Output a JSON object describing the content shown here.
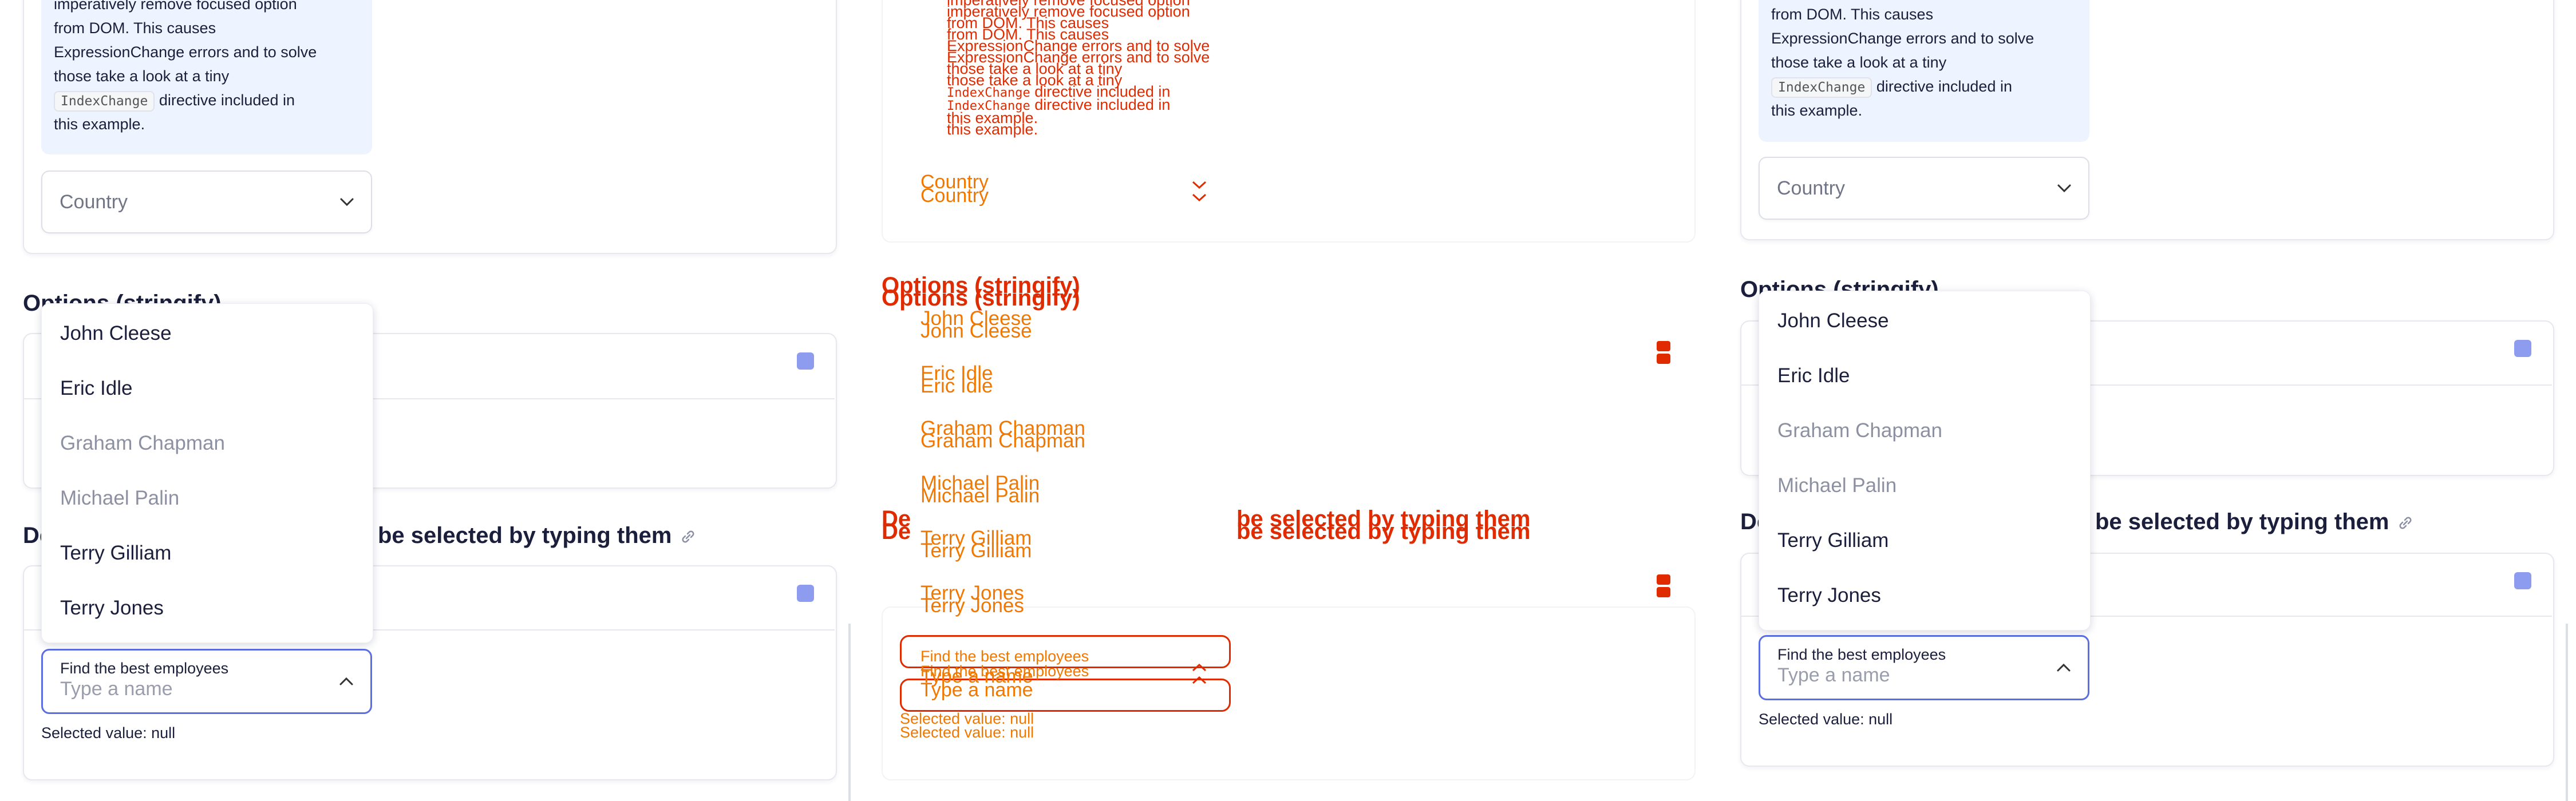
{
  "notice": {
    "line1": "imperatively remove focused option",
    "line2": "from DOM. This causes",
    "line3": "ExpressionChange errors and to solve",
    "line4": "those take a look at a tiny",
    "code": "IndexChange",
    "line5": "directive included in",
    "line6": "this example."
  },
  "country_select": {
    "placeholder": "Country"
  },
  "sections": {
    "options_stringify": "Options (stringify)",
    "typing_title_right": "be selected by typing them",
    "typing_title_left": "De"
  },
  "options": [
    "John Cleese",
    "Eric Idle",
    "Graham Chapman",
    "Michael Palin",
    "Terry Gilliam",
    "Terry Jones"
  ],
  "employee_field": {
    "label": "Find the best employees",
    "placeholder": "Type a name"
  },
  "selected_value": "Selected value: null",
  "colors": {
    "accent": "#5b6fe0",
    "debug_red": "#e02b00",
    "debug_orange": "#f07800",
    "notice_bg": "#edf4ff"
  },
  "icons": [
    "chevron-down-icon",
    "chevron-up-icon",
    "link-icon",
    "bolt-icon"
  ]
}
